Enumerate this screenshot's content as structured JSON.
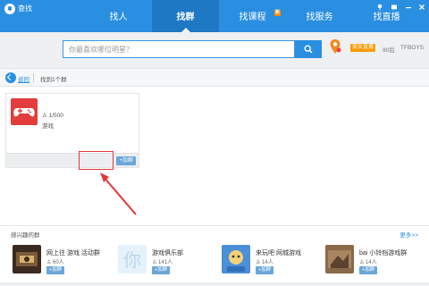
{
  "window": {
    "title": "查找",
    "controls": [
      "pin-icon",
      "skin-icon",
      "minimize-icon",
      "close-icon"
    ]
  },
  "tabs": [
    {
      "label": "找人",
      "active": false
    },
    {
      "label": "找群",
      "active": true
    },
    {
      "label": "找课程",
      "active": false,
      "badge": "新"
    },
    {
      "label": "找服务",
      "active": false
    },
    {
      "label": "找直播",
      "active": false
    }
  ],
  "search": {
    "placeholder": "你最喜欢哪位明星？",
    "button_icon": "search-icon",
    "location_icon": "location-pin-icon",
    "hot_tag": "美女直播",
    "hot_keywords": [
      "90后",
      "TFBOYS"
    ]
  },
  "breadcrumb": {
    "back_label": "返回",
    "found_text": "找到1个群"
  },
  "result_card": {
    "avatar_icon": "gamepad-icon",
    "member_count": "1/500",
    "category": "游戏",
    "join_label": "+加群"
  },
  "interest_section": {
    "title": "感兴趣的群",
    "more_label": "更多>>",
    "items": [
      {
        "name": "网上往 游戏 活动群",
        "members": "60人",
        "join_label": "+加群"
      },
      {
        "name": "游戏俱乐部",
        "members": "141人",
        "join_label": "+加群"
      },
      {
        "name": "来玩吧 网城游戏",
        "members": "14人",
        "join_label": "+加群"
      },
      {
        "name": "bai 小铃铛游戏群",
        "members": "14人",
        "join_label": "+加群"
      }
    ]
  },
  "colors": {
    "brand_blue": "#2a8fe0",
    "active_tab": "#1f78c4",
    "highlight_red": "#e0383a",
    "new_badge": "#ff8a00",
    "join_button": "#6aa6d8"
  }
}
